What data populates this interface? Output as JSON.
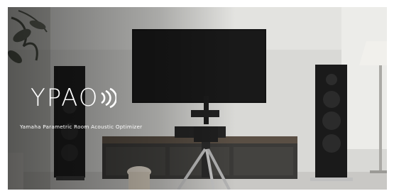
{
  "brand": {
    "logo_text": "YPAO",
    "tagline": "Yamaha Parametric Room Acoustic Optimizer"
  },
  "icons": {
    "logo_waves": "sound-waves-icon"
  },
  "colors": {
    "text": "#ffffff",
    "wall": "#d9d9d6",
    "tv": "#141414",
    "speaker": "#1f1f1f",
    "cabinet": "#3b3a38"
  }
}
